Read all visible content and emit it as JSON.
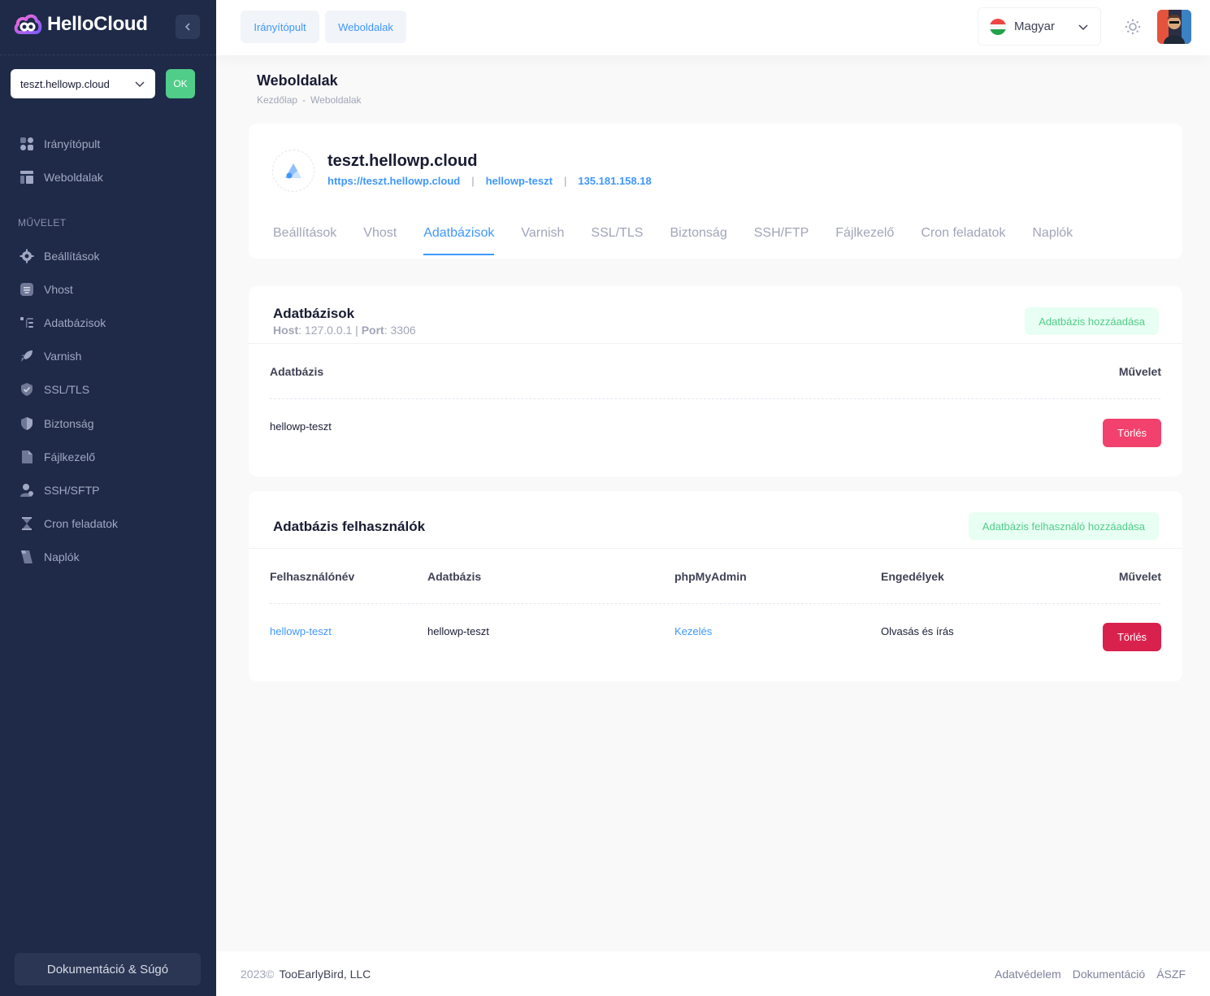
{
  "brand": {
    "name": "HelloCloud"
  },
  "sidebar": {
    "site_select": "teszt.hellowp.cloud",
    "ok_label": "OK",
    "main_items": [
      {
        "label": "Irányítópult",
        "icon": "dashboard-icon"
      },
      {
        "label": "Weboldalak",
        "icon": "layout-icon"
      }
    ],
    "section_label": "MŰVELET",
    "action_items": [
      {
        "label": "Beállítások",
        "icon": "gear-icon"
      },
      {
        "label": "Vhost",
        "icon": "server-icon"
      },
      {
        "label": "Adatbázisok",
        "icon": "database-icon"
      },
      {
        "label": "Varnish",
        "icon": "rocket-icon"
      },
      {
        "label": "SSL/TLS",
        "icon": "shield-check-icon"
      },
      {
        "label": "Biztonság",
        "icon": "shield-icon"
      },
      {
        "label": "Fájlkezelő",
        "icon": "file-icon"
      },
      {
        "label": "SSH/SFTP",
        "icon": "user-icon"
      },
      {
        "label": "Cron feladatok",
        "icon": "hourglass-icon"
      },
      {
        "label": "Naplók",
        "icon": "scroll-icon"
      }
    ],
    "doc_button": "Dokumentáció & Súgó"
  },
  "header": {
    "nav": [
      "Irányítópult",
      "Weboldalak"
    ],
    "language": "Magyar"
  },
  "page": {
    "title": "Weboldalak",
    "breadcrumb": [
      "Kezdőlap",
      "-",
      "Weboldalak"
    ]
  },
  "site": {
    "name": "teszt.hellowp.cloud",
    "url": "https://teszt.hellowp.cloud",
    "user": "hellowp-teszt",
    "ip": "135.181.158.18",
    "tabs": [
      "Beállítások",
      "Vhost",
      "Adatbázisok",
      "Varnish",
      "SSL/TLS",
      "Biztonság",
      "SSH/FTP",
      "Fájlkezelő",
      "Cron feladatok",
      "Naplók"
    ],
    "active_tab": "Adatbázisok"
  },
  "databases": {
    "title": "Adatbázisok",
    "host_label": "Host",
    "host": "127.0.0.1",
    "port_label": "Port",
    "port": "3306",
    "add_button": "Adatbázis hozzáadása",
    "columns": {
      "name": "Adatbázis",
      "action": "Művelet"
    },
    "rows": [
      {
        "name": "hellowp-teszt",
        "action": "Törlés"
      }
    ]
  },
  "db_users": {
    "title": "Adatbázis felhasználók",
    "add_button": "Adatbázis felhasználó hozzáadása",
    "columns": {
      "username": "Felhasználónév",
      "database": "Adatbázis",
      "phpmyadmin": "phpMyAdmin",
      "permissions": "Engedélyek",
      "action": "Művelet"
    },
    "rows": [
      {
        "username": "hellowp-teszt",
        "database": "hellowp-teszt",
        "phpmyadmin": "Kezelés",
        "permissions": "Olvasás és írás",
        "action": "Törlés"
      }
    ]
  },
  "footer": {
    "year": "2023©",
    "company": "TooEarlyBird, LLC",
    "links": [
      "Adatvédelem",
      "Dokumentáció",
      "ÁSZF"
    ]
  },
  "colors": {
    "sidebar_bg": "#1e2a47",
    "primary": "#3e97ff",
    "success": "#50cd89",
    "danger": "#f1416c",
    "danger_dark": "#d9214e"
  }
}
